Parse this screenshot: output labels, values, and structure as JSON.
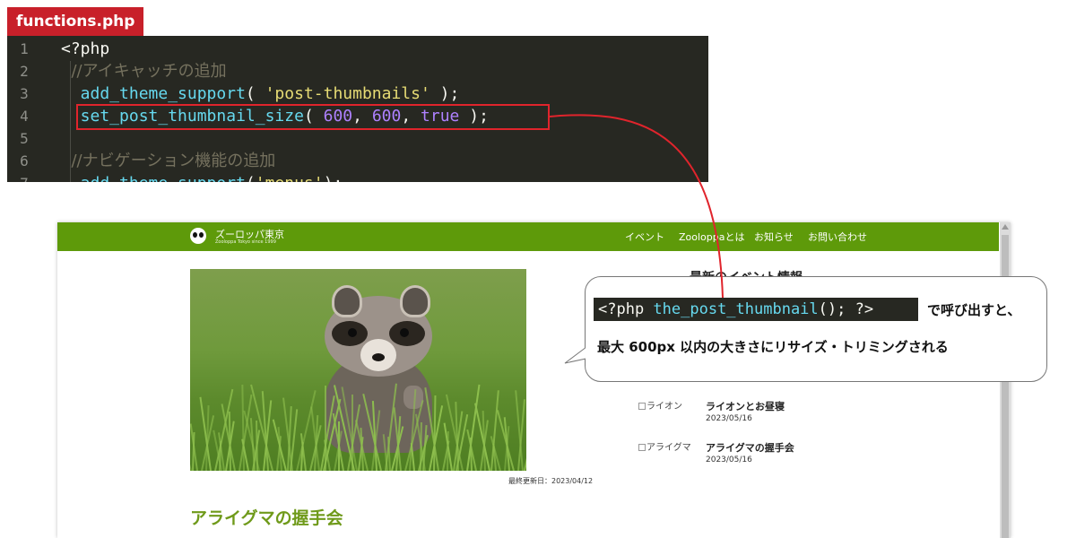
{
  "file_tab": {
    "label": "functions.php"
  },
  "editor": {
    "lines": [
      {
        "num": "1",
        "parts": [
          {
            "t": "<?php",
            "c": ""
          }
        ]
      },
      {
        "num": "2",
        "parts": [
          {
            "t": "  //アイキャッチの追加",
            "c": "c-comment"
          }
        ]
      },
      {
        "num": "3",
        "parts": [
          {
            "t": "  add_theme_support",
            "c": "c-fn"
          },
          {
            "t": "( ",
            "c": ""
          },
          {
            "t": "'post-thumbnails'",
            "c": "c-str"
          },
          {
            "t": " );",
            "c": ""
          }
        ]
      },
      {
        "num": "4",
        "parts": [
          {
            "t": "  set_post_thumbnail_size",
            "c": "c-fn"
          },
          {
            "t": "( ",
            "c": ""
          },
          {
            "t": "600",
            "c": "c-num"
          },
          {
            "t": ", ",
            "c": ""
          },
          {
            "t": "600",
            "c": "c-num"
          },
          {
            "t": ", ",
            "c": ""
          },
          {
            "t": "true",
            "c": "c-num"
          },
          {
            "t": " );",
            "c": ""
          }
        ]
      },
      {
        "num": "5",
        "parts": []
      },
      {
        "num": "6",
        "parts": [
          {
            "t": "  //ナビゲーション機能の追加",
            "c": "c-comment"
          }
        ]
      },
      {
        "num": "7",
        "parts": [
          {
            "t": "  add_theme_support",
            "c": "c-fn"
          },
          {
            "t": "(",
            "c": ""
          },
          {
            "t": "'menus'",
            "c": "c-str"
          },
          {
            "t": ");",
            "c": ""
          }
        ]
      }
    ]
  },
  "site": {
    "logo_name": "ズーロッパ東京",
    "logo_sub": "Zooloppa Tokyo since 1999",
    "nav": [
      "イベント",
      "Zooloppaとは",
      "お知らせ",
      "お問い合わせ"
    ],
    "updated": "最終更新日：2023/04/12",
    "article_title": "アライグマの握手会",
    "sidebar_title": "最新のイベント情報",
    "events": [
      {
        "thumb_alt": "ライオン",
        "name": "ライオンとお昼寝",
        "date": "2023/05/16"
      },
      {
        "thumb_alt": "アライグマ",
        "name": "アライグマの握手会",
        "date": "2023/05/16"
      }
    ]
  },
  "callout": {
    "code_parts": [
      {
        "t": "<?php ",
        "c": ""
      },
      {
        "t": "the_post_thumbnail",
        "c": "c-fn"
      },
      {
        "t": "(); ?>",
        "c": ""
      }
    ],
    "text1": "で呼び出すと、",
    "text2": "最大 600px 以内の大きさにリサイズ・トリミングされる"
  },
  "colors": {
    "accent_red": "#e0242c",
    "site_green": "#5e9a0a",
    "title_green": "#6f9a1a",
    "editor_bg": "#272822"
  }
}
